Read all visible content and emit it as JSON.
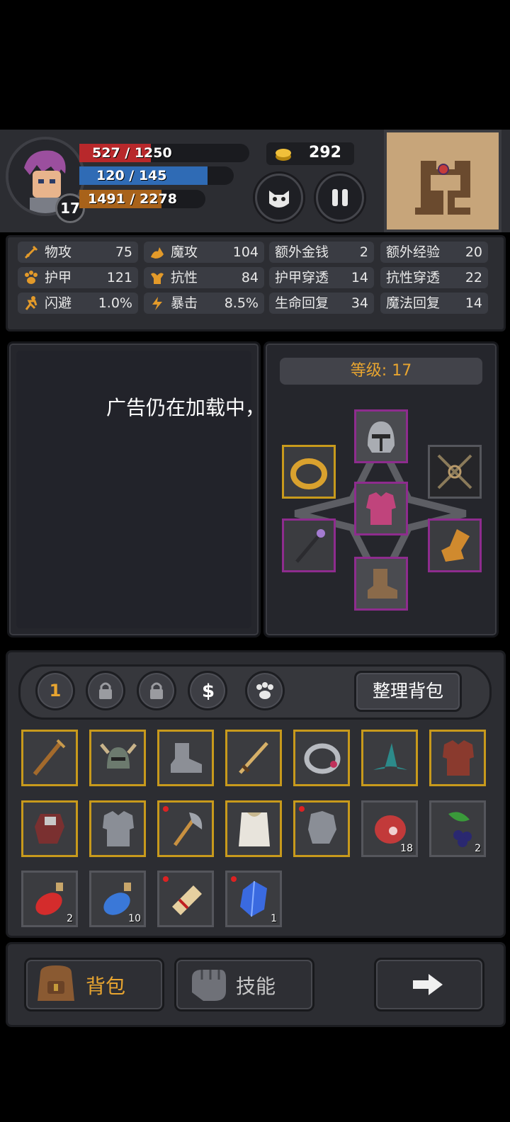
{
  "hud": {
    "level": "17",
    "hp_text": "527 / 1250",
    "hp_fraction": 0.42,
    "mp_text": "120 / 145",
    "mp_fraction": 0.83,
    "xp_text": "1491 / 2278",
    "xp_fraction": 0.65,
    "gold": "292"
  },
  "stats": [
    {
      "label": "物攻",
      "value": "75",
      "icon": "sword-icon"
    },
    {
      "label": "魔攻",
      "value": "104",
      "icon": "magic-hand-icon"
    },
    {
      "label": "额外金钱",
      "value": "2"
    },
    {
      "label": "额外经验",
      "value": "20"
    },
    {
      "label": "护甲",
      "value": "121",
      "icon": "paw-icon"
    },
    {
      "label": "抗性",
      "value": "84",
      "icon": "muscle-icon"
    },
    {
      "label": "护甲穿透",
      "value": "14"
    },
    {
      "label": "抗性穿透",
      "value": "22"
    },
    {
      "label": "闪避",
      "value": "1.0%",
      "icon": "running-icon"
    },
    {
      "label": "暴击",
      "value": "8.5%",
      "icon": "lightning-icon"
    },
    {
      "label": "生命回复",
      "value": "34"
    },
    {
      "label": "魔法回复",
      "value": "14"
    }
  ],
  "ad": {
    "message": "广告仍在加载中，请稍后重试"
  },
  "equipment": {
    "level_label": "等级: 17"
  },
  "inventory": {
    "page_label": "1",
    "sort_label": "整理背包",
    "rows": [
      [
        {
          "name": "staff",
          "count": ""
        },
        {
          "name": "horned-helmet",
          "count": ""
        },
        {
          "name": "iron-boots",
          "count": ""
        },
        {
          "name": "sword",
          "count": ""
        },
        {
          "name": "silver-ring",
          "count": ""
        },
        {
          "name": "wizard-hat",
          "count": ""
        },
        {
          "name": "red-armor",
          "count": ""
        }
      ],
      [
        {
          "name": "gauntlet",
          "count": ""
        },
        {
          "name": "steel-armor",
          "count": ""
        },
        {
          "name": "axe",
          "count": ""
        },
        {
          "name": "white-robe",
          "count": ""
        },
        {
          "name": "steel-gloves",
          "count": ""
        },
        {
          "name": "meat",
          "count": "18"
        },
        {
          "name": "berries",
          "count": "2"
        }
      ],
      [
        {
          "name": "red-potion",
          "count": "2"
        },
        {
          "name": "blue-potion",
          "count": "10"
        },
        {
          "name": "scroll",
          "count": ""
        },
        {
          "name": "blue-gem",
          "count": "1"
        }
      ]
    ]
  },
  "nav": {
    "bag_label": "背包",
    "skills_label": "技能"
  },
  "colors": {
    "gold_border": "#c89a1c",
    "purple_border": "#8e2c8e",
    "accent_text": "#e8a530"
  }
}
